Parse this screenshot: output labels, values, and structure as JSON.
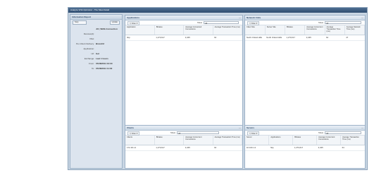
{
  "window": {
    "title": "Analyze VNA Optimizer - The Sites Detail"
  },
  "sidebar": {
    "title": "Information Report",
    "search_placeholder": "Stop",
    "go_label": "Update",
    "rows": [
      {
        "key": "",
        "value": "JCI_WAN-Connection"
      },
      {
        "key": "Devices(2):",
        "value": ""
      },
      {
        "key": "VNA:",
        "value": ""
      },
      {
        "key": "Per-Client Delivery:",
        "value": "Branch2"
      },
      {
        "key": "Application:",
        "value": ""
      },
      {
        "key": "Url:",
        "value": "Get"
      },
      {
        "key": "Exchange:",
        "value": "Last 1 hours"
      },
      {
        "key": "From:",
        "value": "07/28/2014 10:00"
      },
      {
        "key": "To:",
        "value": "07/28/2014 11:00"
      }
    ]
  },
  "show_label": "Show",
  "show_value": "All",
  "filter_label": "Filter",
  "applications": {
    "title": "Applications",
    "columns": [
      "Application",
      "Bitrates",
      "Average Connected Connections",
      "Average Transaction Time (ms)"
    ],
    "rows": [
      [
        "http",
        "1,270,617",
        "3,345",
        "64"
      ]
    ]
  },
  "network_units": {
    "title": "Network Units",
    "columns": [
      "Client Site",
      "Server Site",
      "Bitrates",
      "Average Concurrent Connections",
      "Average Transaction Time (ms)",
      "Average Network Time (ms)"
    ],
    "rows": [
      [
        "North Orland Hills",
        "North Orland Hills",
        "1,270,617",
        "3,345",
        "64",
        "47"
      ]
    ]
  },
  "clients": {
    "title": "Clients",
    "columns": [
      "Clients",
      "Bitrates",
      "Average Concurrent Connections",
      "Average Transaction Time (ms)"
    ],
    "rows": [
      [
        "172.18.1.2",
        "1,270,617",
        "3,345",
        "64"
      ]
    ]
  },
  "servers": {
    "title": "Servers",
    "columns": [
      "Server",
      "Applications",
      "Bitrates",
      "Average Concurrent Connections",
      "Average Transaction Time (ms)"
    ],
    "rows": [
      [
        "10.100.1.2",
        "http",
        "1,270,617",
        "3,345",
        "64"
      ]
    ]
  }
}
